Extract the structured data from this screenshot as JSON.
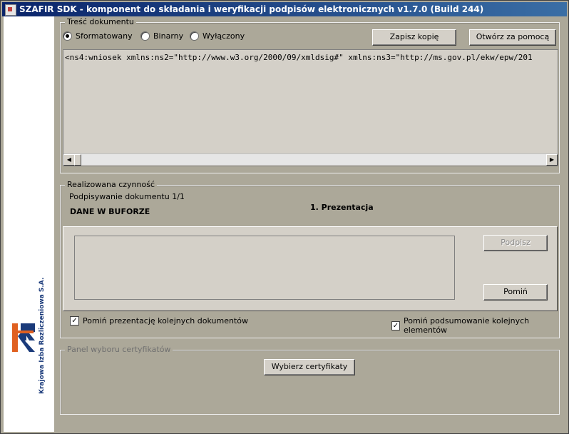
{
  "window": {
    "title": "SZAFIR SDK - komponent do składania i weryfikacji podpisów elektronicznych v1.7.0 (Build 244)"
  },
  "sidebar": {
    "company": "Krajowa Izba Rozliczeniowa S.A."
  },
  "document_panel": {
    "legend": "Treść dokumentu",
    "radios": [
      {
        "label": "Sformatowany",
        "selected": true
      },
      {
        "label": "Binarny",
        "selected": false
      },
      {
        "label": "Wyłączony",
        "selected": false
      }
    ],
    "save_copy_button": "Zapisz kopię",
    "open_with_button": "Otwórz za pomocą",
    "content": "<ns4:wniosek xmlns:ns2=\"http://www.w3.org/2000/09/xmldsig#\" xmlns:ns3=\"http://ms.gov.pl/ekw/epw/201"
  },
  "action_panel": {
    "legend": "Realizowana czynność",
    "signing_status": "Podpisywanie dokumentu 1/1",
    "buffer_label": "DANE W BUFORZE",
    "step_label": "1. Prezentacja",
    "sign_button": "Podpisz",
    "skip_button": "Pomiń",
    "skip_presentation_checkbox": {
      "label": "Pomiń prezentację kolejnych dokumentów",
      "checked": true
    },
    "skip_summary_checkbox": {
      "label": "Pomiń podsumowanie kolejnych elementów",
      "checked": true
    }
  },
  "certificate_panel": {
    "legend": "Panel wyboru certyfikatów",
    "choose_button": "Wybierz certyfikaty"
  },
  "colors": {
    "title_start": "#0a246a",
    "title_end": "#3a6ea5",
    "window_bg": "#aca899",
    "logo_blue": "#1a3a7a",
    "logo_orange": "#e06020"
  }
}
